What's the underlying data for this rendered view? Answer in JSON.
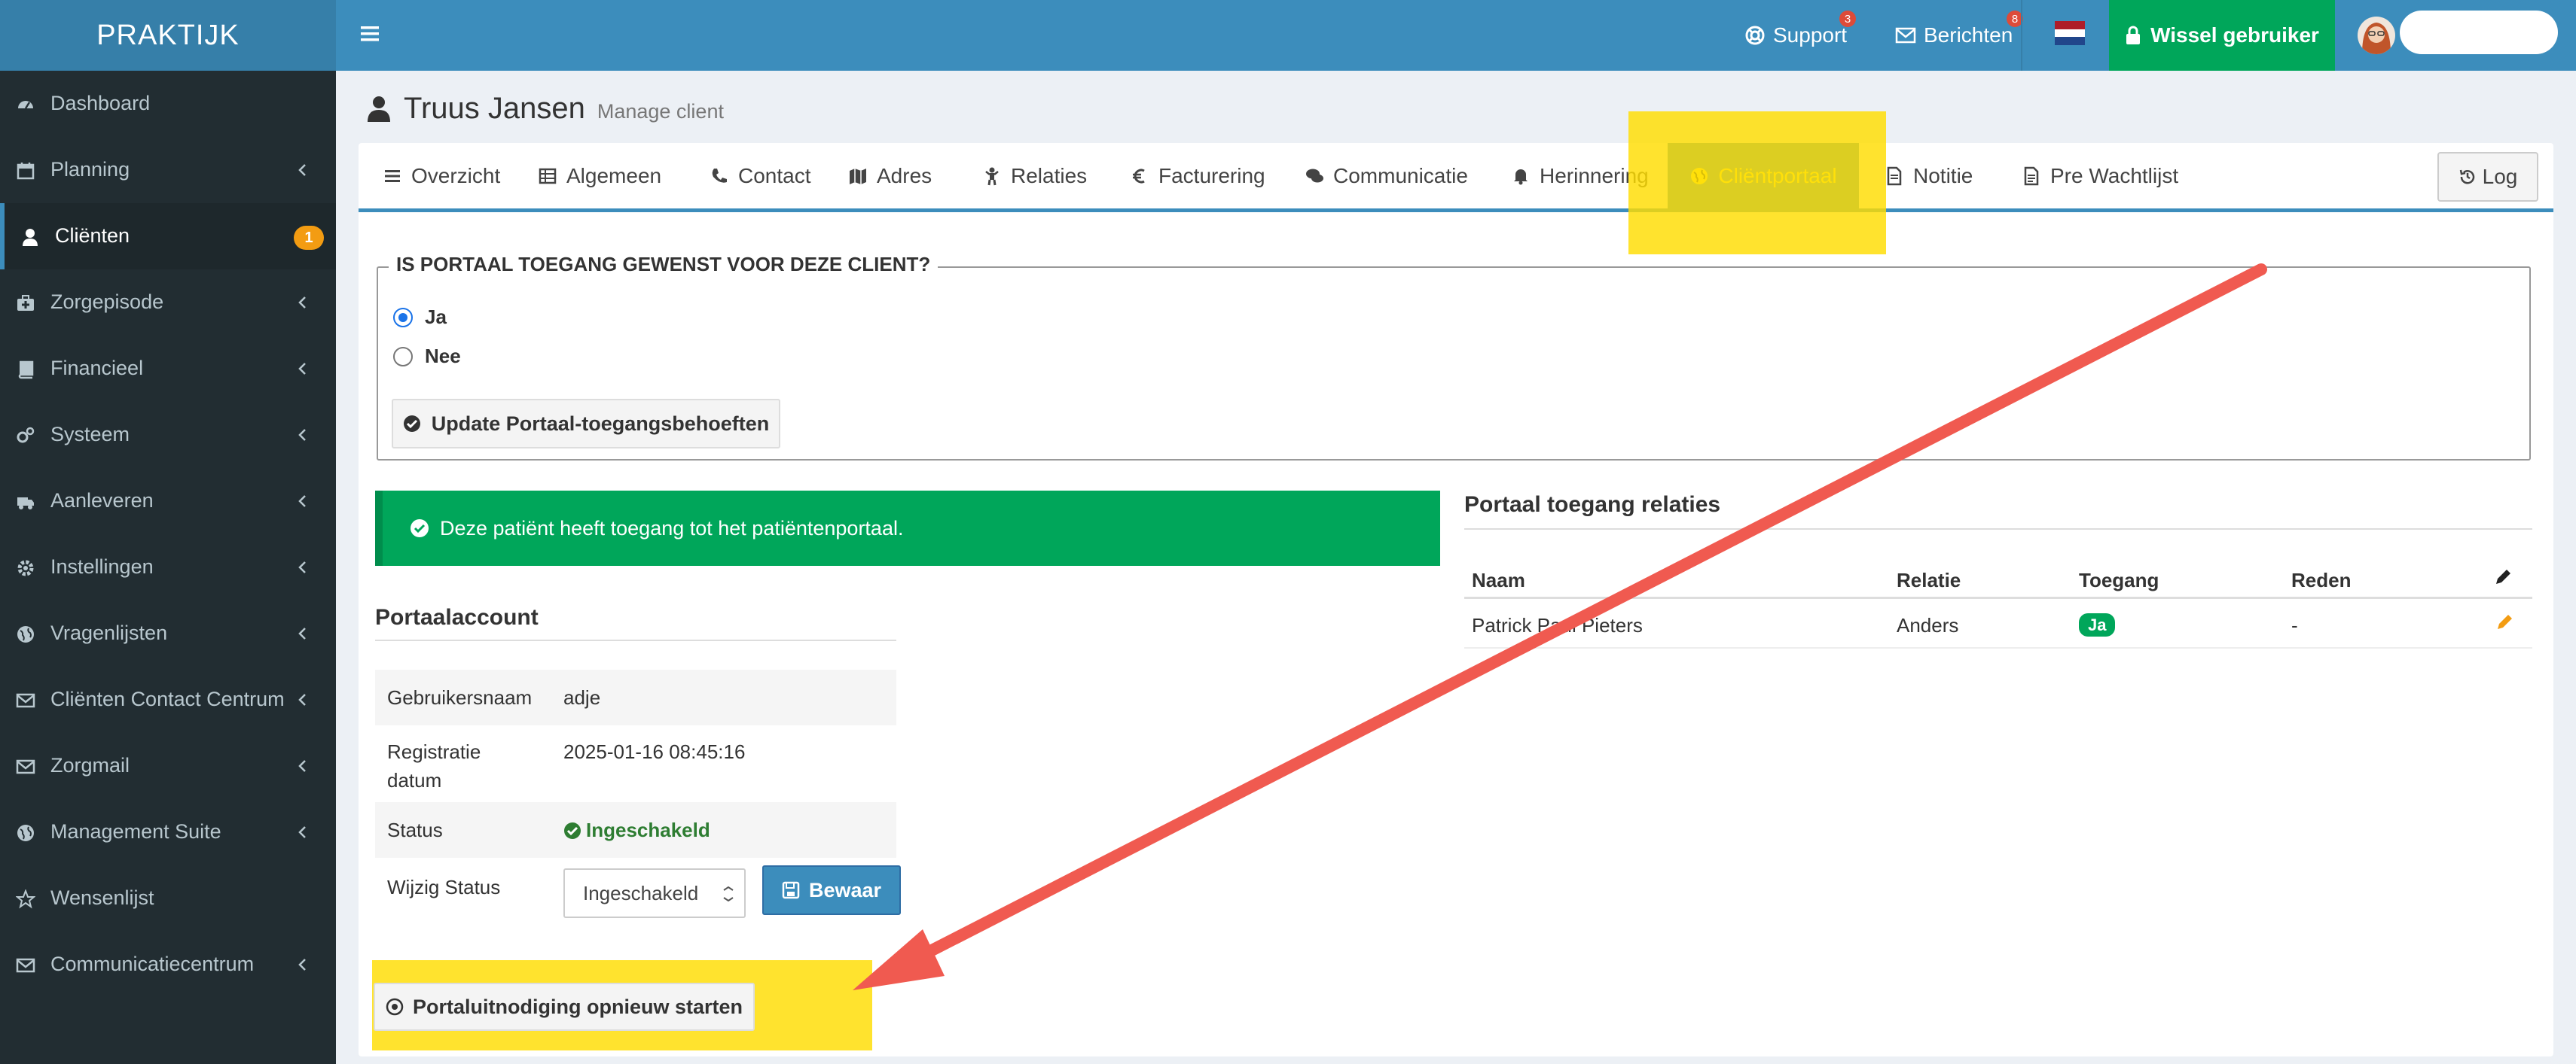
{
  "brand": "PRAKTIJK",
  "colors": {
    "topbar": "#3c8dbc",
    "sidebar": "#222d32",
    "success": "#00a65a",
    "highlight": "#ffdd00",
    "arrow": "#f05a50"
  },
  "sidebar": {
    "items": [
      {
        "label": "Dashboard",
        "icon": "dashboard-icon",
        "chevron": false
      },
      {
        "label": "Planning",
        "icon": "calendar-icon",
        "chevron": true
      },
      {
        "label": "Cliënten",
        "icon": "user-icon",
        "chevron": false,
        "badge": "1",
        "active": true
      },
      {
        "label": "Zorgepisode",
        "icon": "medkit-icon",
        "chevron": true
      },
      {
        "label": "Financieel",
        "icon": "book-icon",
        "chevron": true
      },
      {
        "label": "Systeem",
        "icon": "cogs-icon",
        "chevron": true
      },
      {
        "label": "Aanleveren",
        "icon": "truck-icon",
        "chevron": true
      },
      {
        "label": "Instellingen",
        "icon": "gear-icon",
        "chevron": true
      },
      {
        "label": "Vragenlijsten",
        "icon": "globe-icon",
        "chevron": true
      },
      {
        "label": "Cliënten Contact Centrum",
        "icon": "envelope-icon",
        "chevron": true
      },
      {
        "label": "Zorgmail",
        "icon": "envelope-icon",
        "chevron": true
      },
      {
        "label": "Management Suite",
        "icon": "globe-icon",
        "chevron": true
      },
      {
        "label": "Wensenlijst",
        "icon": "star-icon",
        "chevron": false
      },
      {
        "label": "Communicatiecentrum",
        "icon": "envelope-icon",
        "chevron": true
      }
    ]
  },
  "topbar": {
    "support_label": "Support",
    "support_badge": "3",
    "berichten_label": "Berichten",
    "berichten_badge": "8",
    "language_flag": "flag-nl-icon",
    "switch_user_label": "Wissel gebruiker"
  },
  "page": {
    "title": "Truus Jansen",
    "subtitle": "Manage client"
  },
  "tabs": [
    {
      "label": "Overzicht",
      "icon": "list-icon"
    },
    {
      "label": "Algemeen",
      "icon": "table-icon"
    },
    {
      "label": "Contact",
      "icon": "phone-icon"
    },
    {
      "label": "Adres",
      "icon": "map-icon"
    },
    {
      "label": "Relaties",
      "icon": "child-icon"
    },
    {
      "label": "Facturering",
      "icon": "euro-icon"
    },
    {
      "label": "Communicatie",
      "icon": "comments-icon"
    },
    {
      "label": "Herinnering",
      "icon": "bell-icon"
    },
    {
      "label": "Cliëntportaal",
      "icon": "globe-icon",
      "active": true
    },
    {
      "label": "Notitie",
      "icon": "file-icon"
    },
    {
      "label": "Pre Wachtlijst",
      "icon": "file-text-icon"
    }
  ],
  "log_button": "Log",
  "portal_access": {
    "legend": "IS PORTAAL TOEGANG GEWENST VOOR DEZE CLIENT?",
    "option_yes": "Ja",
    "option_no": "Nee",
    "selected": "Ja",
    "update_button": "Update Portaal-toegangsbehoeften"
  },
  "alert": "Deze patiënt heeft toegang tot het patiëntenportaal.",
  "account": {
    "title": "Portaalaccount",
    "username_label": "Gebruikersnaam",
    "username": "adje",
    "registration_label_1": "Registratie",
    "registration_label_2": "datum",
    "registration_date": "2025-01-16 08:45:16",
    "status_label": "Status",
    "status": "Ingeschakeld",
    "change_status_label": "Wijzig Status",
    "status_select_value": "Ingeschakeld",
    "save_button": "Bewaar",
    "restart_button": "Portaluitnodiging opnieuw starten"
  },
  "relations": {
    "title": "Portaal toegang relaties",
    "headers": {
      "name": "Naam",
      "relation": "Relatie",
      "access": "Toegang",
      "reason": "Reden"
    },
    "rows": [
      {
        "name": "Patrick Paul Pieters",
        "relation": "Anders",
        "access": "Ja",
        "reason": "-"
      }
    ]
  }
}
